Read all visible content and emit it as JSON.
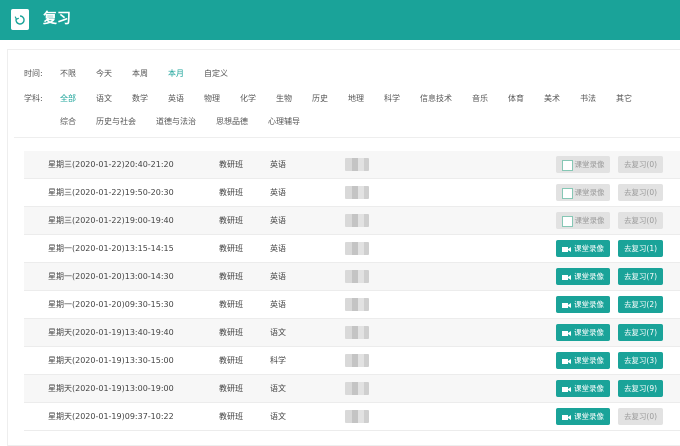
{
  "header": {
    "title": "复习",
    "logo_icon": "refresh-icon"
  },
  "filters": {
    "time_label": "时间:",
    "time_options": [
      "不限",
      "今天",
      "本周",
      "本月",
      "自定义"
    ],
    "time_active": "本月",
    "subject_label": "学科:",
    "subject_options_row1": [
      "全部",
      "语文",
      "数学",
      "英语",
      "物理",
      "化学",
      "生物",
      "历史",
      "地理",
      "科学",
      "信息技术",
      "音乐",
      "体育",
      "美术",
      "书法",
      "其它"
    ],
    "subject_options_row2": [
      "综合",
      "历史与社会",
      "道德与法治",
      "思想品德",
      "心理辅导"
    ],
    "subject_active": "全部"
  },
  "lessons": [
    {
      "time": "星期三(2020-01-22)20:40-21:20",
      "class": "教研班",
      "subject": "英语",
      "record_label": "课堂录像",
      "record_enabled": false,
      "review_label": "去复习(0)",
      "review_enabled": false
    },
    {
      "time": "星期三(2020-01-22)19:50-20:30",
      "class": "教研班",
      "subject": "英语",
      "record_label": "课堂录像",
      "record_enabled": false,
      "review_label": "去复习(0)",
      "review_enabled": false
    },
    {
      "time": "星期三(2020-01-22)19:00-19:40",
      "class": "教研班",
      "subject": "英语",
      "record_label": "课堂录像",
      "record_enabled": false,
      "review_label": "去复习(0)",
      "review_enabled": false
    },
    {
      "time": "星期一(2020-01-20)13:15-14:15",
      "class": "教研班",
      "subject": "英语",
      "record_label": "课堂录像",
      "record_enabled": true,
      "review_label": "去复习(1)",
      "review_enabled": true
    },
    {
      "time": "星期一(2020-01-20)13:00-14:30",
      "class": "教研班",
      "subject": "英语",
      "record_label": "课堂录像",
      "record_enabled": true,
      "review_label": "去复习(7)",
      "review_enabled": true
    },
    {
      "time": "星期一(2020-01-20)09:30-15:30",
      "class": "教研班",
      "subject": "英语",
      "record_label": "课堂录像",
      "record_enabled": true,
      "review_label": "去复习(2)",
      "review_enabled": true
    },
    {
      "time": "星期天(2020-01-19)13:40-19:40",
      "class": "教研班",
      "subject": "语文",
      "record_label": "课堂录像",
      "record_enabled": true,
      "review_label": "去复习(7)",
      "review_enabled": true
    },
    {
      "time": "星期天(2020-01-19)13:30-15:00",
      "class": "教研班",
      "subject": "科学",
      "record_label": "课堂录像",
      "record_enabled": true,
      "review_label": "去复习(3)",
      "review_enabled": true
    },
    {
      "time": "星期天(2020-01-19)13:00-19:00",
      "class": "教研班",
      "subject": "语文",
      "record_label": "课堂录像",
      "record_enabled": true,
      "review_label": "去复习(9)",
      "review_enabled": true
    },
    {
      "time": "星期天(2020-01-19)09:37-10:22",
      "class": "教研班",
      "subject": "语文",
      "record_label": "课堂录像",
      "record_enabled": true,
      "review_label": "去复习(0)",
      "review_enabled": false
    }
  ]
}
